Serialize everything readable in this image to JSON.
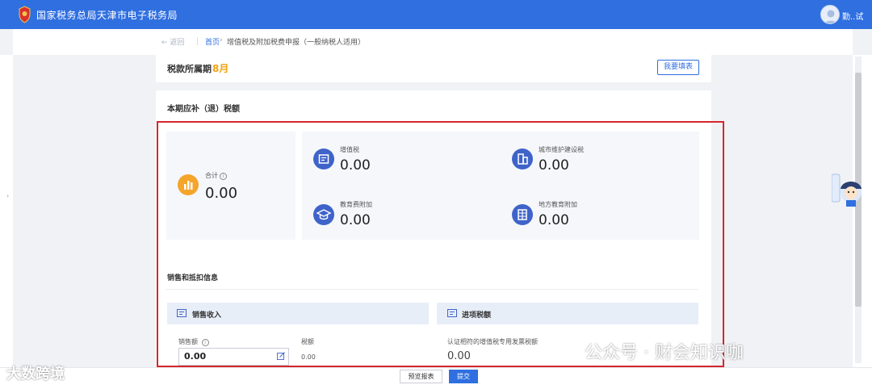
{
  "header": {
    "site_title": "国家税务总局天津市电子税务局",
    "user_name": "勤..试"
  },
  "breadcrumb": {
    "back": "返回",
    "home": "首页",
    "separator": "›",
    "current": "增值税及附加税费申报（一般纳税人适用）"
  },
  "period": {
    "label": "税款所属期",
    "value": "8月",
    "fill_button": "我要填表"
  },
  "summary": {
    "title": "本期应补（退）税额",
    "total": {
      "label": "合计",
      "value": "0.00"
    },
    "taxes": [
      {
        "label": "增值税",
        "value": "0.00",
        "icon": "vat-icon"
      },
      {
        "label": "城市维护建设税",
        "value": "0.00",
        "icon": "building-icon"
      },
      {
        "label": "教育费附加",
        "value": "0.00",
        "icon": "graduation-cap-icon"
      },
      {
        "label": "地方教育附加",
        "value": "0.00",
        "icon": "ledger-icon"
      }
    ]
  },
  "sales": {
    "title": "销售和抵扣信息",
    "revenue_panel": {
      "title": "销售收入",
      "amount_label": "销售额",
      "amount_value": "0.00",
      "tax_label": "税额",
      "tax_value": "0.00"
    },
    "input_tax_panel": {
      "title": "进项税额",
      "certified_label": "认证相符的增值税专用发票税额",
      "certified_value": "0.00"
    }
  },
  "actions": {
    "preview": "预览报表",
    "submit": "提交"
  },
  "watermarks": {
    "left": "大数跨境",
    "right": "公众号 · 财会知识咖"
  },
  "colors": {
    "brand_blue": "#2f6fe0",
    "highlight_red": "#d6262b",
    "period_orange": "#f2a10c",
    "total_icon_orange": "#f5a52a",
    "tax_icon_blue": "#3f63c9"
  }
}
